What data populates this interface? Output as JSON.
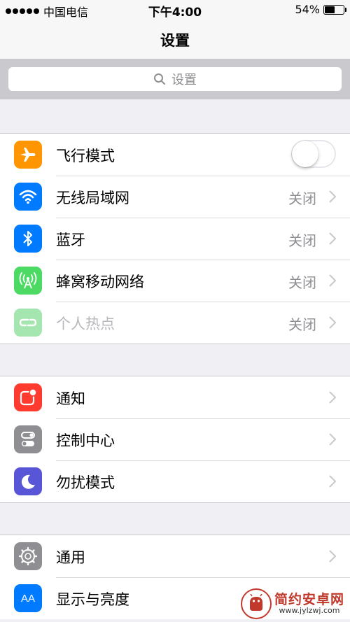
{
  "status_bar": {
    "carrier": "中国电信",
    "time": "下午4:00",
    "battery": "54%"
  },
  "nav": {
    "title": "设置"
  },
  "search": {
    "placeholder": "设置"
  },
  "groups": [
    {
      "rows": [
        {
          "label": "飞行模式",
          "icon": "airplane-icon",
          "color": "#ff9500",
          "toggle": false
        },
        {
          "label": "无线局域网",
          "value": "关闭",
          "icon": "wifi-icon",
          "color": "#007aff"
        },
        {
          "label": "蓝牙",
          "value": "关闭",
          "icon": "bluetooth-icon",
          "color": "#007aff"
        },
        {
          "label": "蜂窝移动网络",
          "value": "关闭",
          "icon": "cellular-icon",
          "color": "#4cd964"
        },
        {
          "label": "个人热点",
          "value": "关闭",
          "icon": "hotspot-icon",
          "color": "#a5e6b0"
        }
      ]
    },
    {
      "rows": [
        {
          "label": "通知",
          "icon": "notifications-icon",
          "color": "#ff3b30"
        },
        {
          "label": "控制中心",
          "icon": "control-center-icon",
          "color": "#8e8e93"
        },
        {
          "label": "勿扰模式",
          "icon": "moon-icon",
          "color": "#5856d6"
        }
      ]
    },
    {
      "rows": [
        {
          "label": "通用",
          "icon": "gear-icon",
          "color": "#8e8e93"
        },
        {
          "label": "显示与亮度",
          "icon": "display-icon",
          "color": "#007aff",
          "icon_text": "AA"
        }
      ]
    }
  ],
  "watermark": {
    "name": "简约安卓网",
    "url": "www.jylzwj.com"
  }
}
